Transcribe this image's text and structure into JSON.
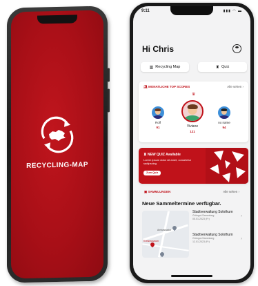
{
  "splash": {
    "brand": "RECYCLING-MAP",
    "colors": {
      "background": "#b0111a",
      "foreground": "#ffffff"
    }
  },
  "status_bar": {
    "time": "9:11",
    "icons": "▮▮▮ ◠ ▬"
  },
  "header": {
    "greeting": "Hi Chris",
    "profile_icon": "user-circle-icon"
  },
  "quick_actions": [
    {
      "label": "Recycling Map",
      "icon": "map-icon"
    },
    {
      "label": "Quiz",
      "icon": "trophy-icon"
    }
  ],
  "top_scores": {
    "title": "MONATLICHE TOP SCORES",
    "link": "Alle sehen",
    "players": [
      {
        "name": "Rolf",
        "score": "91"
      },
      {
        "name": "Viviane",
        "score": "121"
      },
      {
        "name": "no name",
        "score": "94"
      }
    ]
  },
  "quiz_banner": {
    "title": "NEW QUIZ Available",
    "description": "Lorem ipsum dolor sit amet, consetetur sadipscing",
    "button": "Zum Quiz"
  },
  "collections": {
    "title": "SAMMLUNGEN",
    "link": "Alle sehen",
    "heading": "Neue Sammeltermine verfügbar.",
    "map_labels": [
      "Ambassador",
      "Kreismuseum"
    ],
    "entries": [
      {
        "name": "Stadtverwaltung Solothurn",
        "type": "Grüngut-Sammlung",
        "date": "05.01.2023 (Fr)"
      },
      {
        "name": "Stadtverwaltung Solothurn",
        "type": "Grüngut-Sammlung",
        "date": "12.01.2023 (Fr)"
      }
    ]
  },
  "accent_color": "#c0121a"
}
